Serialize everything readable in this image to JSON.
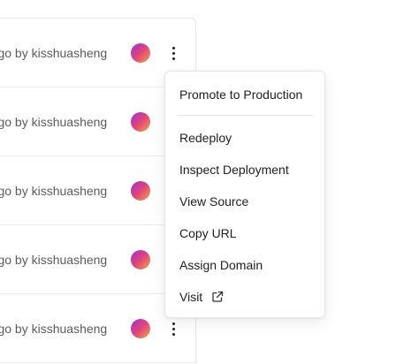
{
  "deployments": [
    {
      "meta": "django by kisshuasheng"
    },
    {
      "meta": "django by kisshuasheng"
    },
    {
      "meta": "django by kisshuasheng"
    },
    {
      "meta": "django by kisshuasheng"
    },
    {
      "meta": "django by kisshuasheng"
    }
  ],
  "menu": {
    "promote": "Promote to Production",
    "redeploy": "Redeploy",
    "inspect": "Inspect Deployment",
    "view_source": "View Source",
    "copy_url": "Copy URL",
    "assign_domain": "Assign Domain",
    "visit": "Visit",
    "visit_icon": "external-link-icon"
  },
  "colors": {
    "avatar_gradient": [
      "#9b2fd8",
      "#e0457a",
      "#f4a24a"
    ],
    "divider": "#e6e6e6",
    "text_muted": "#5b5b5b"
  }
}
